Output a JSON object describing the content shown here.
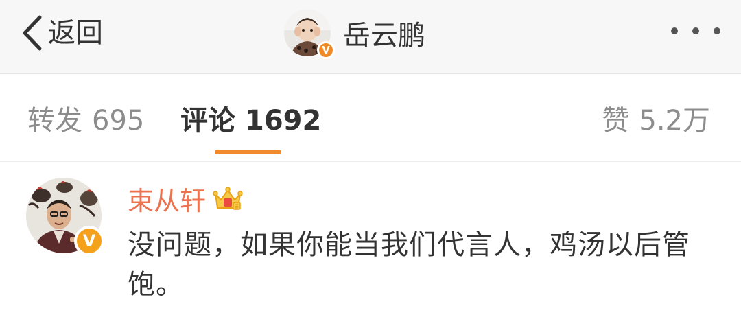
{
  "navbar": {
    "back_label": "返回",
    "title": "岳云鹏",
    "verified_badge": "V",
    "icons": {
      "back": "chevron-left-icon",
      "more": "more-dots-icon"
    }
  },
  "tabs": {
    "repost": {
      "label": "转发",
      "count": "695"
    },
    "comment": {
      "label": "评论",
      "count": "1692"
    },
    "like": {
      "label": "赞",
      "count": "5.2万"
    },
    "active": "comment",
    "accent_color": "#f28a2b"
  },
  "comment": {
    "author": "束从轩",
    "verified_badge": "V",
    "member_icon": "crown-member-icon",
    "text": "没问题，如果你能当我们代言人，鸡汤以后管饱。",
    "name_color": "#eb7350"
  }
}
